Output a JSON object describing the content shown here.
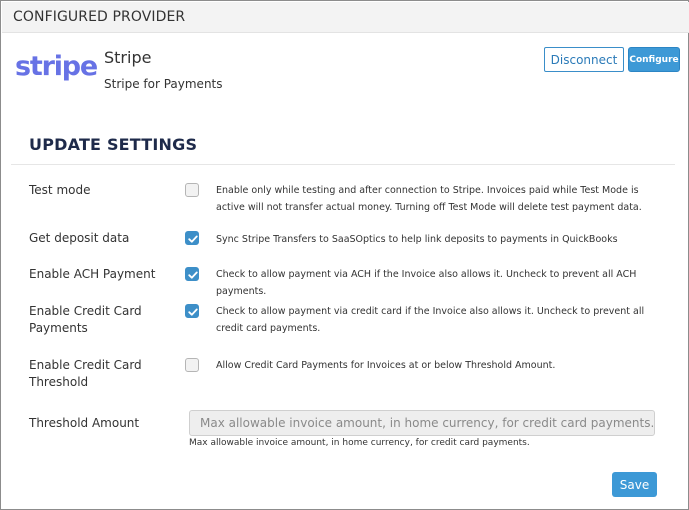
{
  "header": {
    "title": "CONFIGURED PROVIDER"
  },
  "provider": {
    "logo_text": "stripe",
    "name": "Stripe",
    "description": "Stripe for Payments",
    "brand_color": "#6772e5"
  },
  "actions": {
    "disconnect_label": "Disconnect",
    "configure_label": "Configure"
  },
  "settings": {
    "title": "UPDATE SETTINGS",
    "rows": [
      {
        "label": "Test mode",
        "checked": false,
        "description": "Enable only while testing and after connection to Stripe. Invoices paid while Test Mode is active will not transfer actual money. Turning off Test Mode will delete test payment data."
      },
      {
        "label": "Get deposit data",
        "checked": true,
        "description": "Sync Stripe Transfers to SaaSOptics to help link deposits to payments in QuickBooks"
      },
      {
        "label": "Enable ACH Payment",
        "checked": true,
        "description": "Check to allow payment via ACH if the Invoice also allows it. Uncheck to prevent all ACH payments."
      },
      {
        "label": "Enable Credit Card Payments",
        "checked": true,
        "description": "Check to allow payment via credit card if the Invoice also allows it. Uncheck to prevent all credit card payments."
      },
      {
        "label": "Enable Credit Card Threshold",
        "checked": false,
        "description": "Allow Credit Card Payments for Invoices at or below Threshold Amount."
      }
    ],
    "threshold": {
      "label": "Threshold Amount",
      "value": "",
      "placeholder": "Max allowable invoice amount, in home currency, for credit card payments.",
      "help": "Max allowable invoice amount, in home currency, for credit card payments."
    },
    "save_label": "Save"
  },
  "colors": {
    "accent": "#3d99d6",
    "checkbox_on": "#3d8fc8",
    "title_dark": "#1e2a4a"
  }
}
